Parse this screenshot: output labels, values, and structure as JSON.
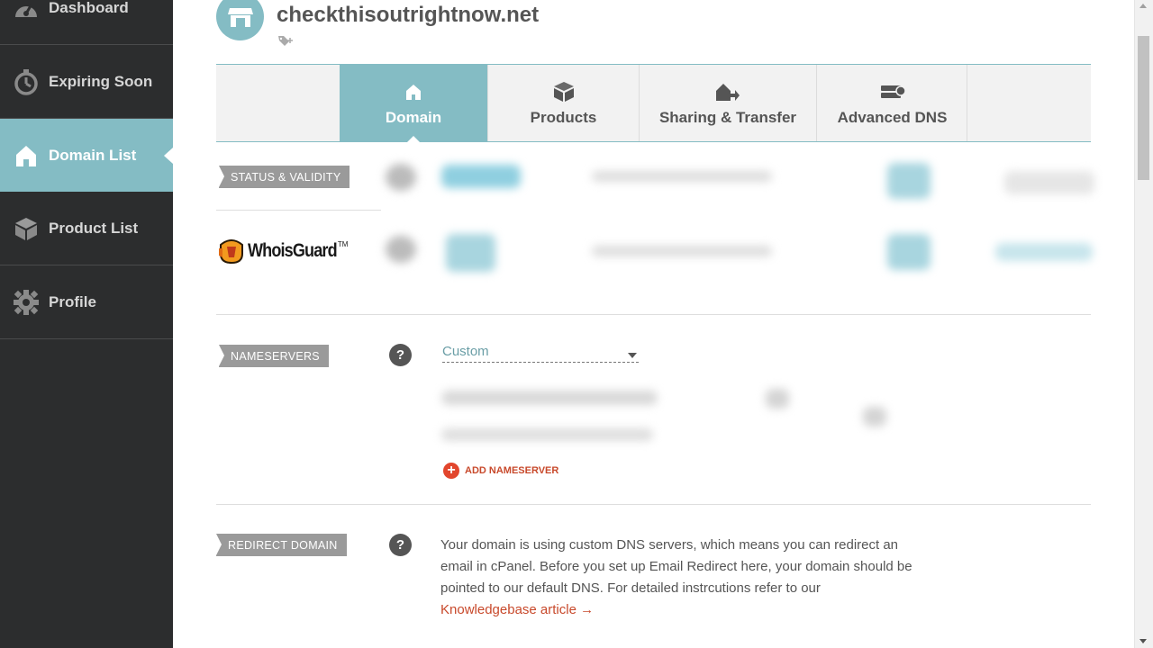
{
  "sidebar": {
    "items": [
      {
        "label": "Dashboard",
        "icon": "dashboard-icon"
      },
      {
        "label": "Expiring Soon",
        "icon": "stopwatch-icon"
      },
      {
        "label": "Domain List",
        "icon": "home-icon",
        "active": true
      },
      {
        "label": "Product List",
        "icon": "box-icon"
      },
      {
        "label": "Profile",
        "icon": "gear-icon"
      }
    ]
  },
  "header": {
    "domain": "checkthisoutrightnow.net",
    "avatar_icon": "store-icon",
    "tag_icon": "tag-add-icon"
  },
  "tabs": [
    {
      "label": "Domain",
      "icon": "home-icon",
      "active": true
    },
    {
      "label": "Products",
      "icon": "box-icon"
    },
    {
      "label": "Sharing & Transfer",
      "icon": "transfer-icon"
    },
    {
      "label": "Advanced DNS",
      "icon": "server-icon"
    }
  ],
  "sections": {
    "status": {
      "label": "STATUS & VALIDITY"
    },
    "whoisguard": {
      "brand": "WhoisGuard",
      "tm": "TM"
    },
    "nameservers": {
      "label": "NAMESERVERS",
      "help": "?",
      "dropdown_value": "Custom",
      "add_label": "ADD NAMESERVER"
    },
    "redirect": {
      "label": "REDIRECT DOMAIN",
      "help": "?",
      "text": "Your domain is using custom DNS servers, which means you can redirect an email in cPanel. Before you set up Email Redirect here, your domain should be pointed to our default DNS. For detailed instrcutions refer to our",
      "link": "Knowledgebase article →"
    }
  },
  "colors": {
    "sidebar_bg": "#2c2d2e",
    "accent": "#84bcc4",
    "link": "#c8492b",
    "label_bg": "#9a9a9a"
  }
}
